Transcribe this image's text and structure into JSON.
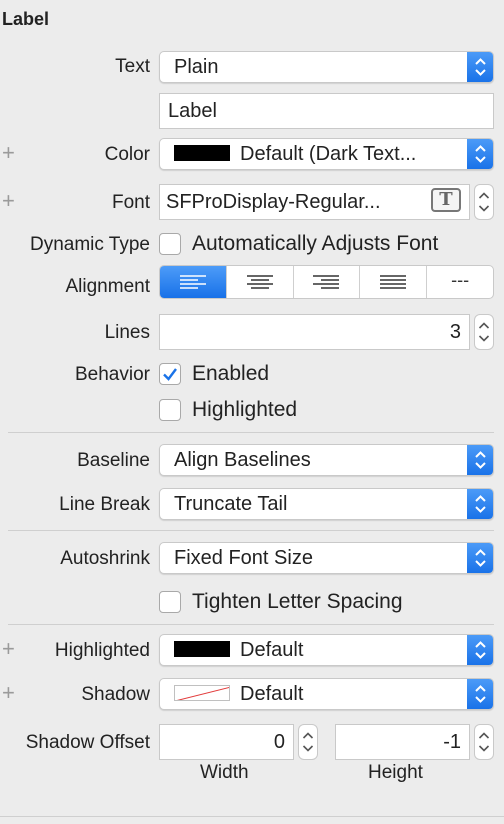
{
  "section_title": "Label",
  "text": {
    "label": "Text",
    "value": "Plain",
    "content": "Label"
  },
  "color": {
    "label": "Color",
    "value": "Default (Dark Text..."
  },
  "font": {
    "label": "Font",
    "value": "SFProDisplay-Regular...",
    "button_glyph": "T"
  },
  "dynamic_type": {
    "label": "Dynamic Type",
    "checkbox_label": "Automatically Adjusts Font",
    "checked": false
  },
  "alignment": {
    "label": "Alignment",
    "options": [
      "left",
      "center",
      "right",
      "justified",
      "natural"
    ],
    "natural_glyph": "---",
    "selected": "left"
  },
  "lines": {
    "label": "Lines",
    "value": "3"
  },
  "behavior": {
    "label": "Behavior",
    "enabled_label": "Enabled",
    "enabled_checked": true,
    "highlighted_label": "Highlighted",
    "highlighted_checked": false
  },
  "baseline": {
    "label": "Baseline",
    "value": "Align Baselines"
  },
  "line_break": {
    "label": "Line Break",
    "value": "Truncate Tail"
  },
  "autoshrink": {
    "label": "Autoshrink",
    "value": "Fixed Font Size",
    "tighten_label": "Tighten Letter Spacing",
    "tighten_checked": false
  },
  "highlighted": {
    "label": "Highlighted",
    "value": "Default"
  },
  "shadow": {
    "label": "Shadow",
    "value": "Default"
  },
  "shadow_offset": {
    "label": "Shadow Offset",
    "width_value": "0",
    "height_value": "-1",
    "width_caption": "Width",
    "height_caption": "Height"
  },
  "colors": {
    "accent": "#1a73e8",
    "background": "#ececec",
    "swatch": "#000000"
  },
  "plus_glyph": "+"
}
